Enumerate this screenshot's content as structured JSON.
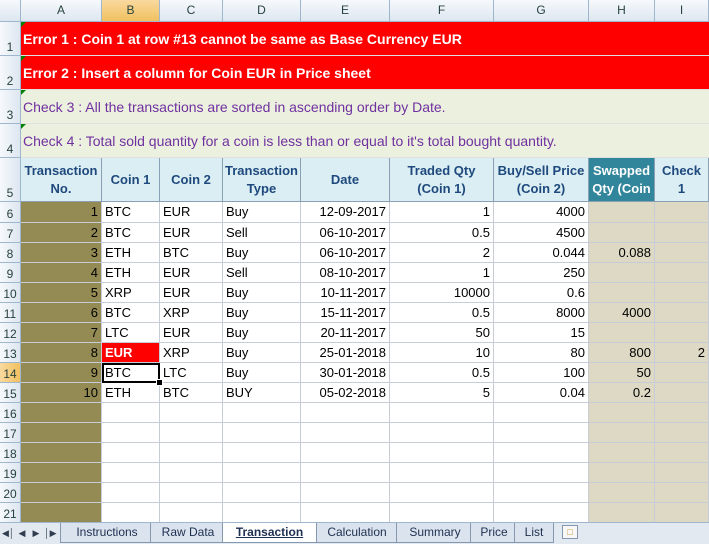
{
  "columns": [
    "A",
    "B",
    "C",
    "D",
    "E",
    "F",
    "G",
    "H",
    "I"
  ],
  "selected_column": "B",
  "selected_row": "14",
  "messages": [
    {
      "row": "1",
      "text": "Error 1 : Coin 1 at row #13 cannot be same as Base Currency EUR",
      "kind": "error"
    },
    {
      "row": "2",
      "text": "Error 2 : Insert a column for Coin EUR in Price sheet",
      "kind": "error"
    },
    {
      "row": "3",
      "text": "Check 3 : All the transactions are sorted in ascending order by Date.",
      "kind": "check"
    },
    {
      "row": "4",
      "text": "Check 4 : Total sold quantity for a coin is less than or equal to it's total bought quantity.",
      "kind": "check"
    }
  ],
  "header_row": "5",
  "headers": [
    "Transaction No.",
    "Coin 1",
    "Coin 2",
    "Transaction Type",
    "Date",
    "Traded Qty (Coin 1)",
    "Buy/Sell Price (Coin 2)",
    "Swapped Qty (Coin",
    "Check 1"
  ],
  "rows": [
    {
      "row": "6",
      "cells": [
        "1",
        "BTC",
        "EUR",
        "Buy",
        "12-09-2017",
        "1",
        "4000",
        "",
        ""
      ]
    },
    {
      "row": "7",
      "cells": [
        "2",
        "BTC",
        "EUR",
        "Sell",
        "06-10-2017",
        "0.5",
        "4500",
        "",
        ""
      ]
    },
    {
      "row": "8",
      "cells": [
        "3",
        "ETH",
        "BTC",
        "Buy",
        "06-10-2017",
        "2",
        "0.044",
        "0.088",
        ""
      ]
    },
    {
      "row": "9",
      "cells": [
        "4",
        "ETH",
        "EUR",
        "Sell",
        "08-10-2017",
        "1",
        "250",
        "",
        ""
      ]
    },
    {
      "row": "10",
      "cells": [
        "5",
        "XRP",
        "EUR",
        "Buy",
        "10-11-2017",
        "10000",
        "0.6",
        "",
        ""
      ]
    },
    {
      "row": "11",
      "cells": [
        "6",
        "BTC",
        "XRP",
        "Buy",
        "15-11-2017",
        "0.5",
        "8000",
        "4000",
        ""
      ]
    },
    {
      "row": "12",
      "cells": [
        "7",
        "LTC",
        "EUR",
        "Buy",
        "20-11-2017",
        "50",
        "15",
        "",
        ""
      ]
    },
    {
      "row": "13",
      "cells": [
        "8",
        "EUR",
        "XRP",
        "Buy",
        "25-01-2018",
        "10",
        "80",
        "800",
        "2"
      ]
    },
    {
      "row": "14",
      "cells": [
        "9",
        "BTC",
        "LTC",
        "Buy",
        "30-01-2018",
        "0.5",
        "100",
        "50",
        ""
      ]
    },
    {
      "row": "15",
      "cells": [
        "10",
        "ETH",
        "BTC",
        "BUY",
        "05-02-2018",
        "5",
        "0.04",
        "0.2",
        ""
      ]
    },
    {
      "row": "16",
      "cells": [
        "",
        "",
        "",
        "",
        "",
        "",
        "",
        "",
        ""
      ]
    },
    {
      "row": "17",
      "cells": [
        "",
        "",
        "",
        "",
        "",
        "",
        "",
        "",
        ""
      ]
    },
    {
      "row": "18",
      "cells": [
        "",
        "",
        "",
        "",
        "",
        "",
        "",
        "",
        ""
      ]
    },
    {
      "row": "19",
      "cells": [
        "",
        "",
        "",
        "",
        "",
        "",
        "",
        "",
        ""
      ]
    },
    {
      "row": "20",
      "cells": [
        "",
        "",
        "",
        "",
        "",
        "",
        "",
        "",
        ""
      ]
    },
    {
      "row": "21",
      "cells": [
        "",
        "",
        "",
        "",
        "",
        "",
        "",
        "",
        ""
      ]
    }
  ],
  "sheet_tabs": [
    "Instructions",
    "Raw Data",
    "Transaction",
    "Calculation",
    "Summary",
    "Price",
    "List"
  ],
  "active_tab": "Transaction",
  "tab_nav_icons": [
    "first-sheet-icon",
    "prev-sheet-icon",
    "next-sheet-icon",
    "last-sheet-icon"
  ],
  "colors": {
    "error_bg": "#ff0000",
    "check_bg": "#ebf1de",
    "check_text": "#7030a0",
    "header_bg": "#daeef3",
    "header_text": "#1f497d",
    "swapped_header_bg": "#31869b",
    "column_a_bg": "#948a54",
    "swapped_col_bg": "#ddd9c4"
  }
}
